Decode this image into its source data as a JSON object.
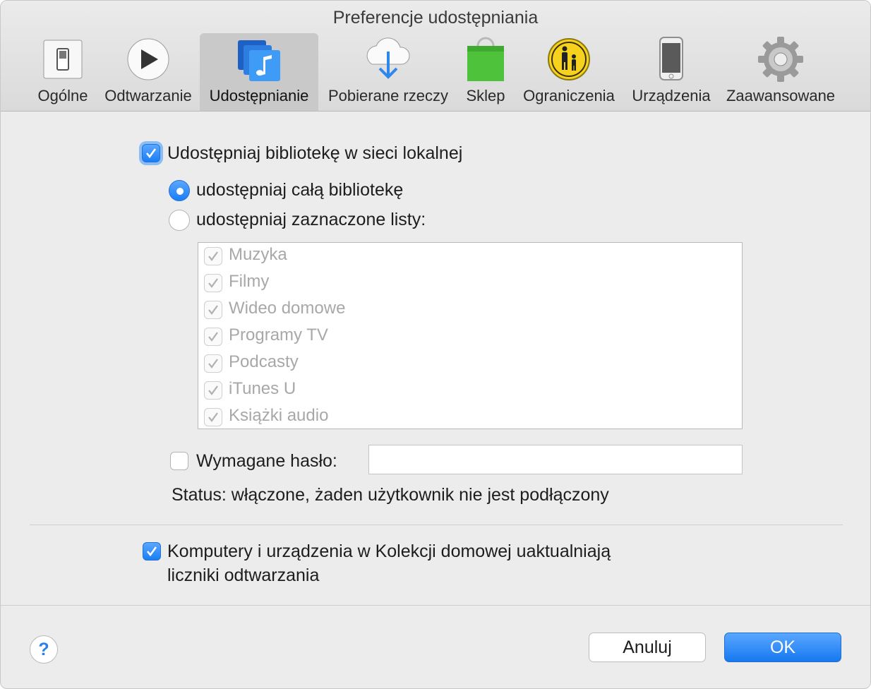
{
  "window": {
    "title": "Preferencje udostępniania"
  },
  "tabs": [
    {
      "label": "Ogólne",
      "icon": "switch-icon"
    },
    {
      "label": "Odtwarzanie",
      "icon": "play-icon"
    },
    {
      "label": "Udostępnianie",
      "icon": "music-stack-icon",
      "selected": true
    },
    {
      "label": "Pobierane rzeczy",
      "icon": "cloud-download-icon"
    },
    {
      "label": "Sklep",
      "icon": "shopping-bag-icon"
    },
    {
      "label": "Ograniczenia",
      "icon": "parental-controls-icon"
    },
    {
      "label": "Urządzenia",
      "icon": "iphone-icon"
    },
    {
      "label": "Zaawansowane",
      "icon": "gear-icon"
    }
  ],
  "sharing": {
    "share_library_label": "Udostępniaj bibliotekę w sieci lokalnej",
    "share_library_checked": true,
    "share_all_label": "udostępniaj całą bibliotekę",
    "share_selected_label": "udostępniaj zaznaczone listy:",
    "selected_option": "share_all",
    "playlists": [
      {
        "label": "Muzyka",
        "checked": true
      },
      {
        "label": "Filmy",
        "checked": true
      },
      {
        "label": "Wideo domowe",
        "checked": true
      },
      {
        "label": "Programy TV",
        "checked": true
      },
      {
        "label": "Podcasty",
        "checked": true
      },
      {
        "label": "iTunes U",
        "checked": true
      },
      {
        "label": "Książki audio",
        "checked": true
      }
    ],
    "password_label": "Wymagane hasło:",
    "password_checked": false,
    "password_value": "",
    "status": "Status: włączone, żaden użytkownik nie jest podłączony"
  },
  "home_sharing": {
    "line1": "Komputery i urządzenia w Kolekcji domowej uaktualniają",
    "line2": "liczniki odtwarzania",
    "checked": true
  },
  "footer": {
    "help_label": "?",
    "cancel_label": "Anuluj",
    "ok_label": "OK"
  },
  "colors": {
    "accent": "#1a7ef5",
    "disabled_text": "#a8a8a8"
  }
}
